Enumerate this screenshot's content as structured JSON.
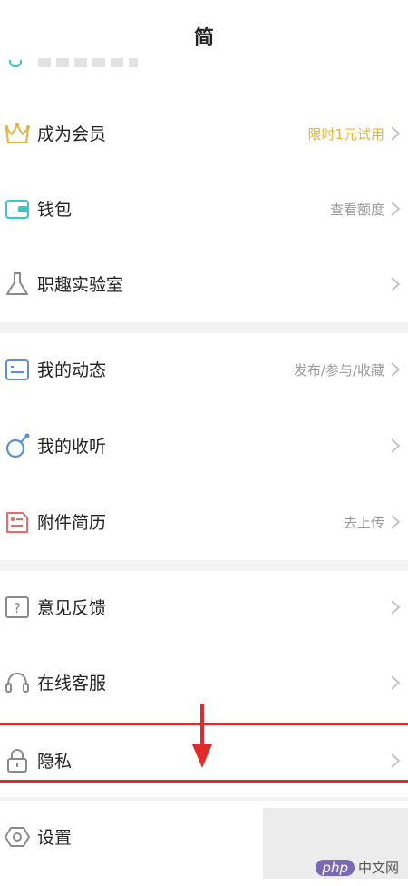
{
  "header": {
    "title": "简"
  },
  "menu": [
    {
      "id": "member",
      "label": "成为会员",
      "value": "限时1元试用",
      "icon": "crown-icon",
      "value_color": "#e3b33d"
    },
    {
      "id": "wallet",
      "label": "钱包",
      "value": "查看额度",
      "icon": "wallet-icon"
    },
    {
      "id": "lab",
      "label": "职趣实验室",
      "value": "",
      "icon": "flask-icon"
    },
    {
      "id": "activity",
      "label": "我的动态",
      "value": "发布/参与/收藏",
      "icon": "feed-icon"
    },
    {
      "id": "listen",
      "label": "我的收听",
      "value": "",
      "icon": "listen-icon"
    },
    {
      "id": "resume",
      "label": "附件简历",
      "value": "去上传",
      "icon": "resume-icon"
    },
    {
      "id": "feedback",
      "label": "意见反馈",
      "value": "",
      "icon": "help-icon"
    },
    {
      "id": "service",
      "label": "在线客服",
      "value": "",
      "icon": "headset-icon"
    },
    {
      "id": "privacy",
      "label": "隐私",
      "value": "",
      "icon": "lock-icon"
    },
    {
      "id": "settings",
      "label": "设置",
      "value": "",
      "icon": "settings-icon"
    }
  ],
  "watermark": {
    "logo": "php",
    "text": "中文网"
  },
  "colors": {
    "accent_teal": "#3ec6c6",
    "gold": "#e3b33d",
    "annotation_red": "#e02b2b",
    "resume_red": "#e86b6b"
  }
}
